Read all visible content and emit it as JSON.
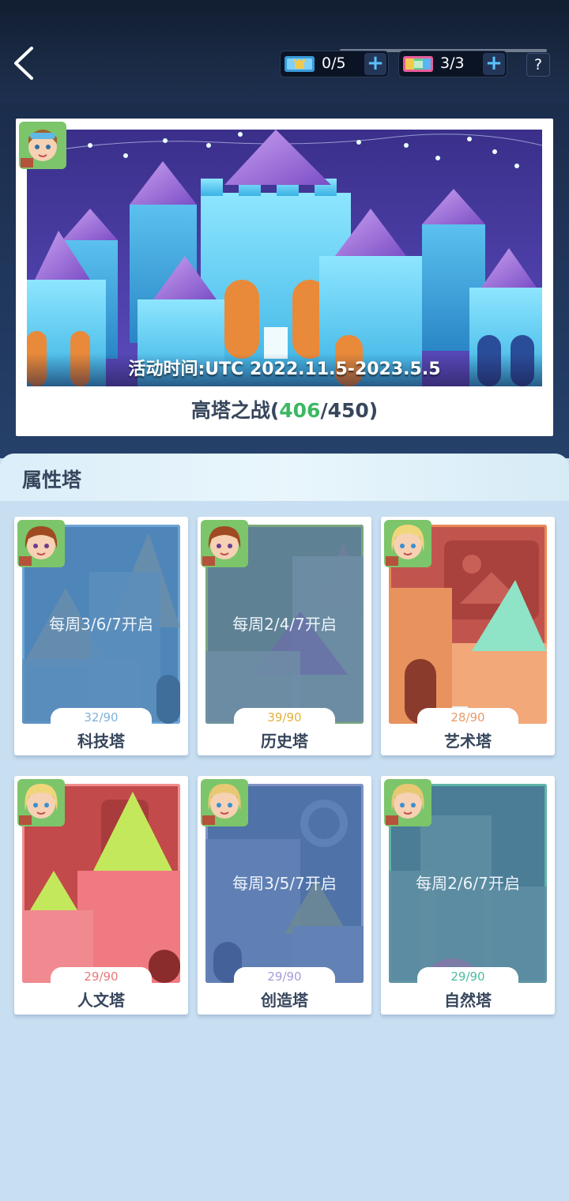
{
  "header": {
    "back_label": "返回",
    "counters": [
      {
        "value": "0/5"
      },
      {
        "value": "3/3"
      }
    ],
    "help_label": "?"
  },
  "banner": {
    "event_time": "活动时间:UTC 2022.11.5-2023.5.5",
    "title_prefix": "高塔之战(",
    "progress_current": "406",
    "progress_sep_total": "/450)"
  },
  "section": {
    "title": "属性塔"
  },
  "towers": [
    {
      "name": "科技塔",
      "progress": "32/90",
      "schedule": "每周3/6/7开启",
      "locked": true,
      "progress_color": "#7fb2dc"
    },
    {
      "name": "历史塔",
      "progress": "39/90",
      "schedule": "每周2/4/7开启",
      "locked": true,
      "progress_color": "#e2b23a"
    },
    {
      "name": "艺术塔",
      "progress": "28/90",
      "schedule": "",
      "locked": false,
      "progress_color": "#e89a6a"
    },
    {
      "name": "人文塔",
      "progress": "29/90",
      "schedule": "",
      "locked": false,
      "progress_color": "#e87a7a"
    },
    {
      "name": "创造塔",
      "progress": "29/90",
      "schedule": "每周3/5/7开启",
      "locked": true,
      "progress_color": "#a79ad8"
    },
    {
      "name": "自然塔",
      "progress": "29/90",
      "schedule": "每周2/6/7开启",
      "locked": true,
      "progress_color": "#4dbba0"
    }
  ]
}
